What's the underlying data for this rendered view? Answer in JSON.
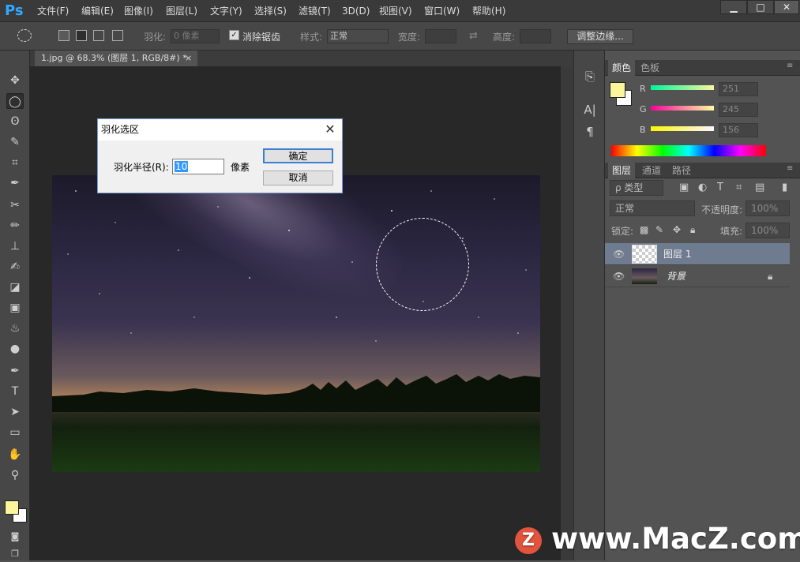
{
  "app": {
    "logo": "Ps"
  },
  "menu": [
    "文件(F)",
    "编辑(E)",
    "图像(I)",
    "图层(L)",
    "文字(Y)",
    "选择(S)",
    "滤镜(T)",
    "3D(D)",
    "视图(V)",
    "窗口(W)",
    "帮助(H)"
  ],
  "window_controls": {
    "minimize": "▁",
    "maximize": "□",
    "close": "✕"
  },
  "options": {
    "feather_label": "羽化:",
    "feather_value": "0 像素",
    "antialias_label": "消除锯齿",
    "antialias_checked": true,
    "style_label": "样式:",
    "style_value": "正常",
    "width_label": "宽度:",
    "height_label": "高度:",
    "refine_edge": "调整边缘..."
  },
  "document": {
    "tab_title": "1.jpg @ 68.3% (图层 1, RGB/8#) *",
    "tab_close": "×"
  },
  "dialog": {
    "title": "羽化选区",
    "radius_label": "羽化半径(R):",
    "radius_value": "10",
    "unit": "像素",
    "ok": "确定",
    "cancel": "取消"
  },
  "color_panel": {
    "tabs": [
      "颜色",
      "色板"
    ],
    "r_label": "R",
    "r_value": "251",
    "g_label": "G",
    "g_value": "245",
    "b_label": "B",
    "b_value": "156",
    "foreground": "#fbf59c",
    "background": "#ffffff"
  },
  "layers_panel": {
    "tabs": [
      "图层",
      "通道",
      "路径"
    ],
    "filter_label": "ρ 类型",
    "blend_mode": "正常",
    "opacity_label": "不透明度:",
    "opacity_value": "100%",
    "lock_label": "锁定:",
    "fill_label": "填充:",
    "fill_value": "100%",
    "layers": [
      {
        "name": "图层 1",
        "selected": true
      },
      {
        "name": "背景",
        "locked": true
      }
    ]
  },
  "watermark": "www.MacZ.com",
  "watermark_logo": "Z"
}
